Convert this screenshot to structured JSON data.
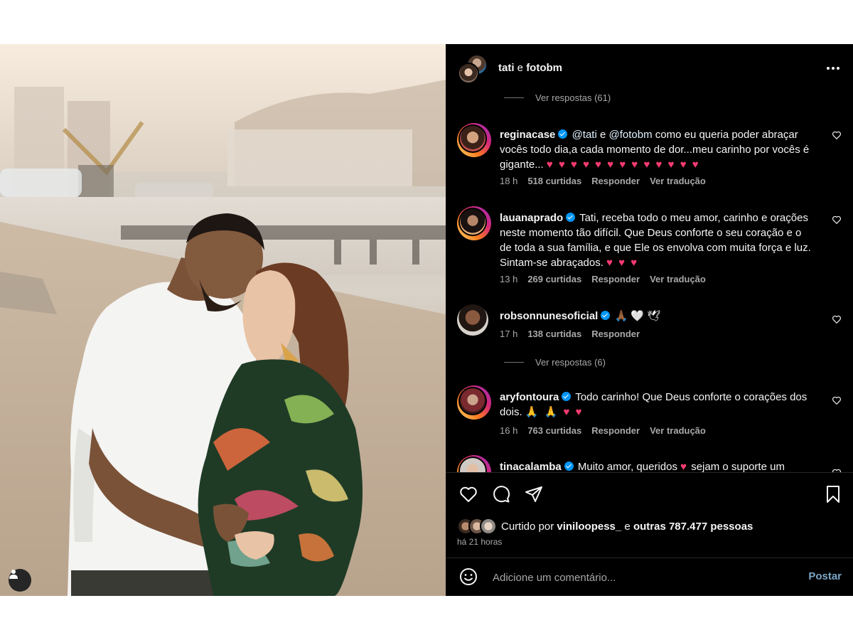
{
  "header": {
    "user1": "tati",
    "connector": "e",
    "user2": "fotobm"
  },
  "comments": {
    "replies_top": "Ver respostas (61)",
    "replies_mid": "Ver respostas (6)",
    "items": [
      {
        "user": "reginacase",
        "segments": [
          "@tati",
          " e ",
          "@fotobm",
          " como eu queria poder abraçar vocês todo dia,a cada momento de dor...meu carinho por vocês é gigante..."
        ],
        "emojis": "♥ ♥ ♥ ♥ ♥ ♥ ♥ ♥ ♥ ♥ ♥ ♥ ♥",
        "time": "18 h",
        "likes": "518 curtidas",
        "reply": "Responder",
        "translate": "Ver tradução"
      },
      {
        "user": "lauanaprado",
        "text": "Tati, receba todo o meu amor, carinho e orações neste momento tão difícil. Que Deus conforte o seu coração e o de toda a sua família, e que Ele os envolva com muita força e luz. Sintam-se abraçados.",
        "emojis": "♥ ♥ ♥",
        "time": "13 h",
        "likes": "269 curtidas",
        "reply": "Responder",
        "translate": "Ver tradução"
      },
      {
        "user": "robsonnunesoficial",
        "emojis": "🙏🏾 🤍 🕊",
        "time": "17 h",
        "likes": "138 curtidas",
        "reply": "Responder"
      },
      {
        "user": "aryfontoura",
        "text": "Todo carinho! Que Deus conforte o corações dos dois.",
        "emojis": "🙏 🙏 ♥ ♥",
        "time": "16 h",
        "likes": "763 curtidas",
        "reply": "Responder",
        "translate": "Ver tradução"
      },
      {
        "user": "tinacalamba",
        "text": "Muito amor, queridos",
        "emojis": "♥",
        "text2": "sejam o suporte um"
      }
    ]
  },
  "likes": {
    "prefix": "Curtido por",
    "user": "viniloopess_",
    "connector": "e",
    "others": "outras 787.477 pessoas"
  },
  "time_ago": "há 21 horas",
  "comment_bar": {
    "placeholder": "Adicione um comentário...",
    "post_label": "Postar"
  },
  "icons": {
    "like": "heart-icon",
    "comment": "comment-bubble-icon",
    "share": "paper-plane-icon",
    "save": "bookmark-icon",
    "emoji": "smiley-icon",
    "more": "ellipsis-icon",
    "tag": "user-tag-icon"
  },
  "colors": {
    "panel_bg": "#000000",
    "text_primary": "#f5f5f5",
    "text_secondary": "#a8a8a8",
    "verified": "#0095f6",
    "heart": "#ff3b72",
    "post_button": "#7aa6c7"
  }
}
